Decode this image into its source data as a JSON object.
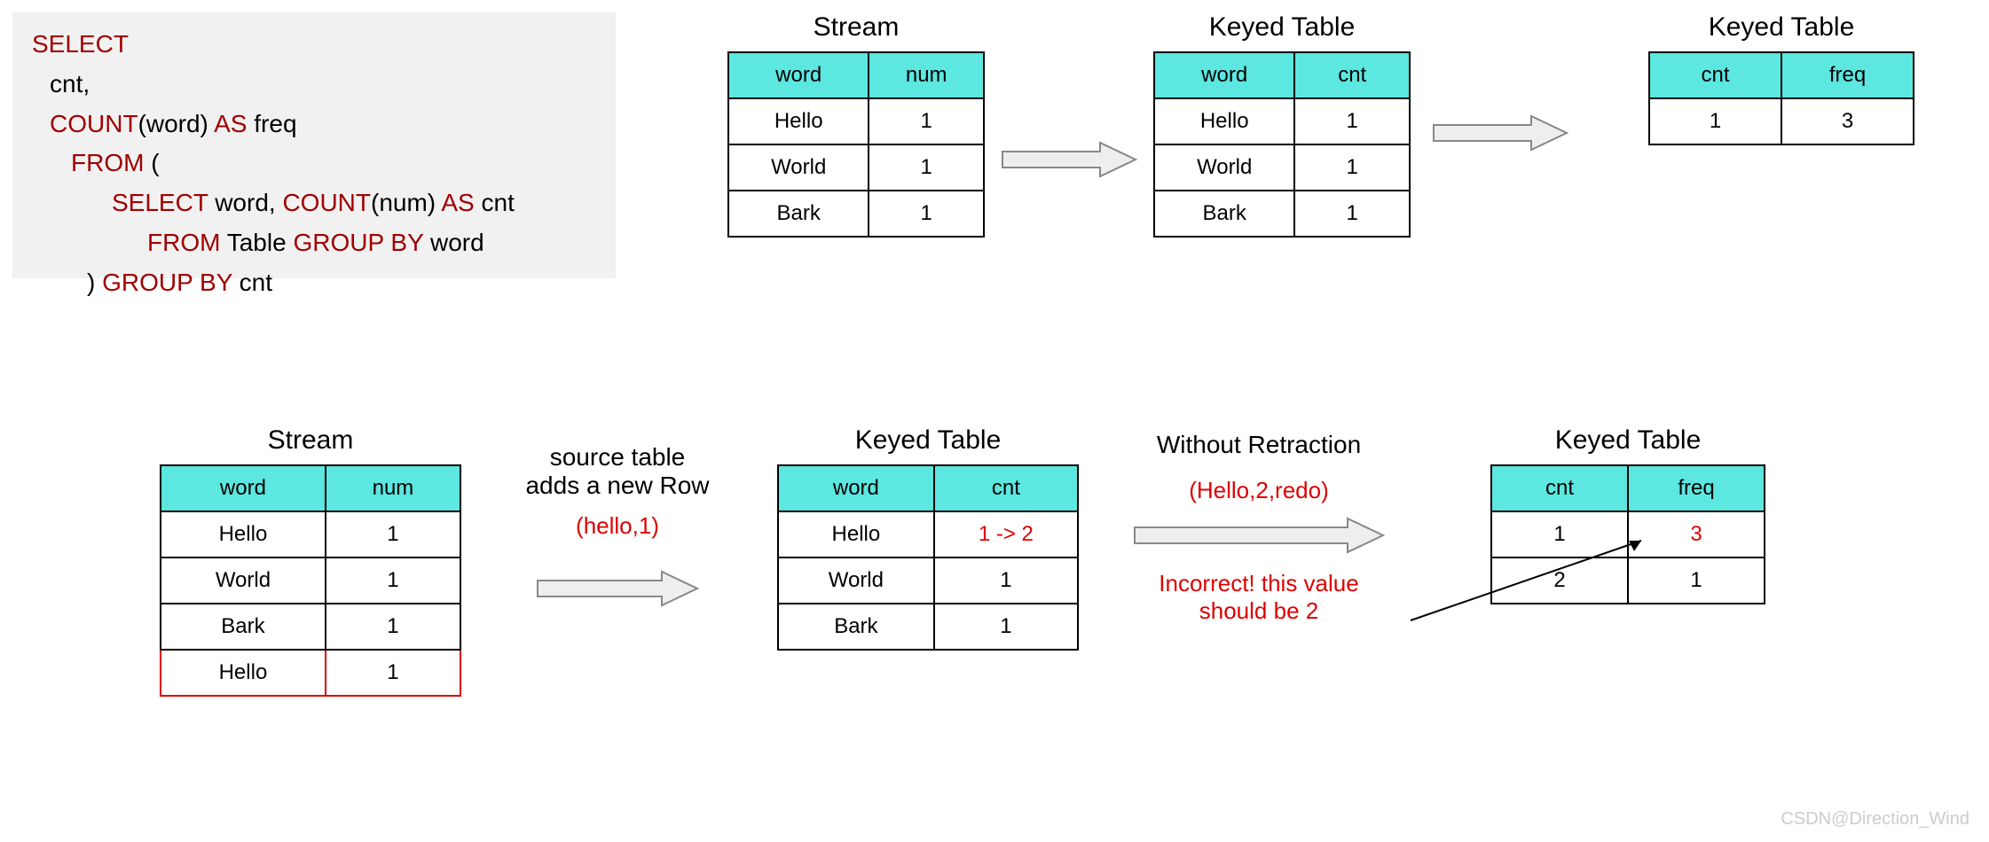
{
  "sql": {
    "l1": "SELECT",
    "l2_a": "cnt,",
    "l3_kw1": "COUNT",
    "l3_a": "(word)",
    "l3_kw2": "AS",
    "l3_b": " freq",
    "l4_kw": "FROM",
    "l4_a": "  (",
    "l5_kw1": "SELECT",
    "l5_a": " word,  ",
    "l5_kw2": "COUNT",
    "l5_b": "(num)",
    "l5_kw3": "AS",
    "l5_c": " cnt",
    "l6_kw1": "FROM",
    "l6_a": " Table ",
    "l6_kw2": "GROUP BY",
    "l6_b": " word",
    "l7_a": ") ",
    "l7_kw": "GROUP BY",
    "l7_b": " cnt"
  },
  "top_stream": {
    "title": "Stream",
    "headers": [
      "word",
      "num"
    ],
    "rows": [
      [
        "Hello",
        "1"
      ],
      [
        "World",
        "1"
      ],
      [
        "Bark",
        "1"
      ]
    ]
  },
  "top_keyed": {
    "title": "Keyed Table",
    "headers": [
      "word",
      "cnt"
    ],
    "rows": [
      [
        "Hello",
        "1"
      ],
      [
        "World",
        "1"
      ],
      [
        "Bark",
        "1"
      ]
    ]
  },
  "top_result": {
    "title": "Keyed Table",
    "headers": [
      "cnt",
      "freq"
    ],
    "rows": [
      [
        "1",
        "3"
      ]
    ]
  },
  "bot_stream": {
    "title": "Stream",
    "headers": [
      "word",
      "num"
    ],
    "rows": [
      [
        "Hello",
        "1"
      ],
      [
        "World",
        "1"
      ],
      [
        "Bark",
        "1"
      ],
      [
        "Hello",
        "1"
      ]
    ]
  },
  "bot_keyed": {
    "title": "Keyed Table",
    "headers": [
      "word",
      "cnt"
    ],
    "rows": [
      [
        "Hello",
        "1 -> 2"
      ],
      [
        "World",
        "1"
      ],
      [
        "Bark",
        "1"
      ]
    ]
  },
  "bot_result": {
    "title": "Keyed Table",
    "headers": [
      "cnt",
      "freq"
    ],
    "rows": [
      [
        "1",
        "3"
      ],
      [
        "2",
        "1"
      ]
    ]
  },
  "labels": {
    "source_add": "source table\nadds a new Row",
    "hello1": "(hello,1)",
    "without": "Without Retraction",
    "hello_redo": "(Hello,2,redo)",
    "incorrect": "Incorrect! this value\nshould be 2"
  },
  "watermark": "CSDN@Direction_Wind",
  "chart_data": [
    {
      "type": "table",
      "title": "Stream",
      "columns": [
        "word",
        "num"
      ],
      "rows": [
        [
          "Hello",
          1
        ],
        [
          "World",
          1
        ],
        [
          "Bark",
          1
        ]
      ]
    },
    {
      "type": "table",
      "title": "Keyed Table",
      "columns": [
        "word",
        "cnt"
      ],
      "rows": [
        [
          "Hello",
          1
        ],
        [
          "World",
          1
        ],
        [
          "Bark",
          1
        ]
      ]
    },
    {
      "type": "table",
      "title": "Keyed Table",
      "columns": [
        "cnt",
        "freq"
      ],
      "rows": [
        [
          1,
          3
        ]
      ]
    },
    {
      "type": "table",
      "title": "Stream (after add)",
      "columns": [
        "word",
        "num"
      ],
      "rows": [
        [
          "Hello",
          1
        ],
        [
          "World",
          1
        ],
        [
          "Bark",
          1
        ],
        [
          "Hello",
          1
        ]
      ]
    },
    {
      "type": "table",
      "title": "Keyed Table (after add)",
      "columns": [
        "word",
        "cnt"
      ],
      "rows": [
        [
          "Hello",
          "1 -> 2"
        ],
        [
          "World",
          1
        ],
        [
          "Bark",
          1
        ]
      ]
    },
    {
      "type": "table",
      "title": "Keyed Table result (without retraction)",
      "columns": [
        "cnt",
        "freq"
      ],
      "rows": [
        [
          1,
          3
        ],
        [
          2,
          1
        ]
      ],
      "note": "value 3 should be 2"
    }
  ]
}
